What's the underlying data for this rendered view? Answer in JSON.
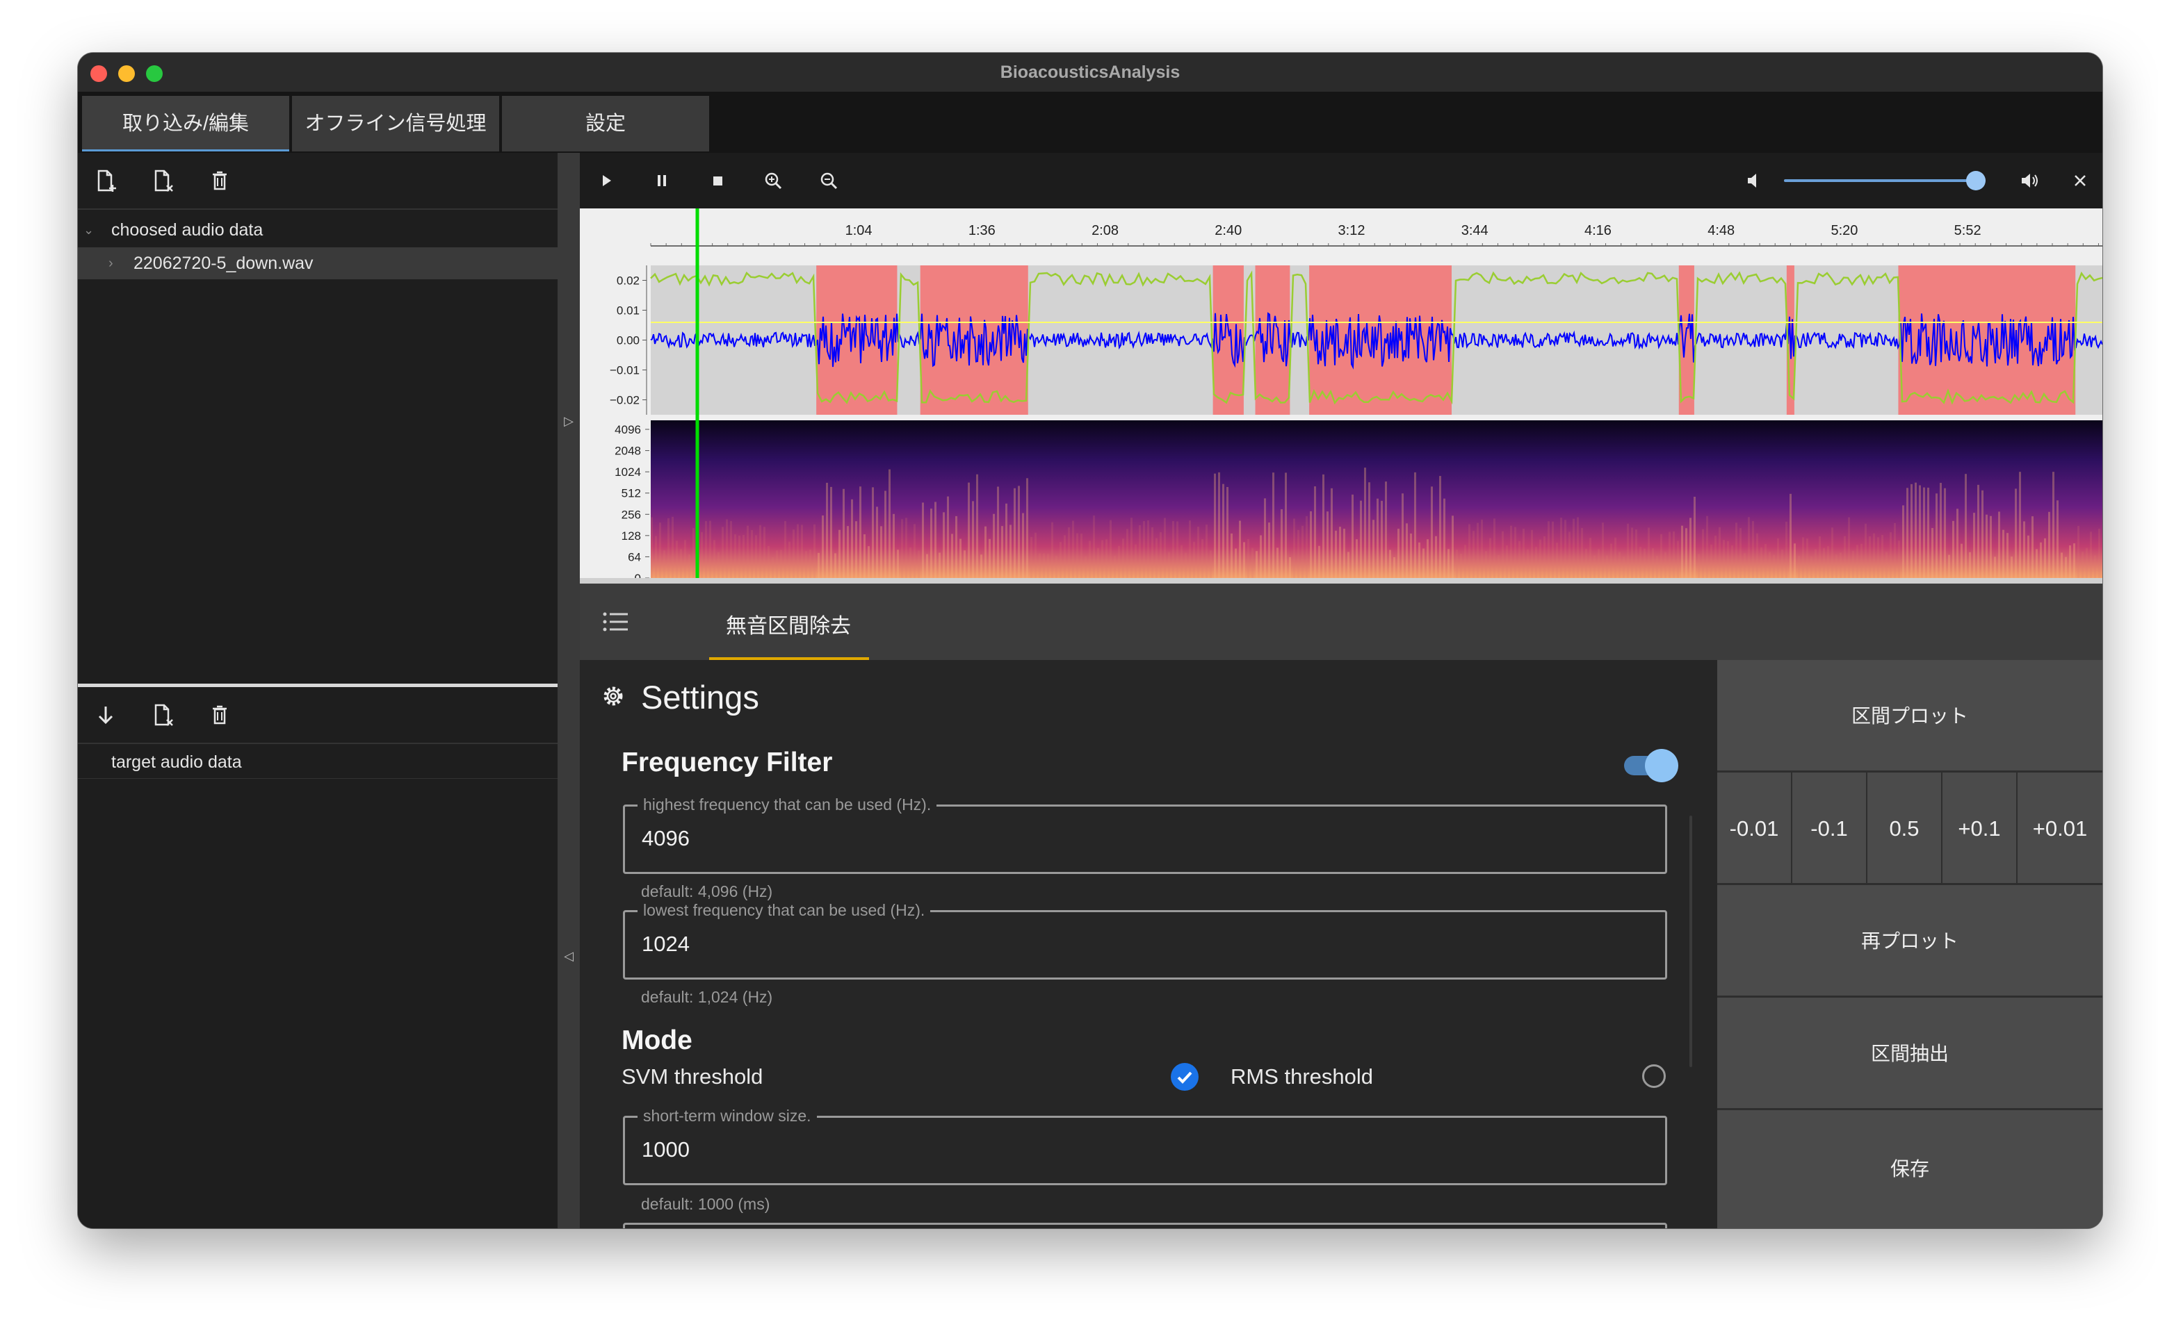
{
  "window": {
    "title": "BioacousticsAnalysis"
  },
  "tabs": [
    {
      "label": "取り込み/編集"
    },
    {
      "label": "オフライン信号処理"
    },
    {
      "label": "設定"
    }
  ],
  "left_panel": {
    "source_tree": {
      "root_label": "choosed audio data",
      "children": [
        "22062720-5_down.wav"
      ]
    },
    "target_tree": {
      "root_label": "target audio data"
    }
  },
  "player": {
    "icons": [
      "play-icon",
      "pause-icon",
      "stop-icon",
      "zoom-in-icon",
      "zoom-out-icon",
      "volume-mute-icon",
      "volume-up-icon",
      "close-icon"
    ],
    "volume": 1.0
  },
  "chart_data": [
    {
      "type": "line",
      "time_ticks": [
        "1:04",
        "1:36",
        "2:08",
        "2:40",
        "3:12",
        "3:44",
        "4:16",
        "4:48",
        "5:20",
        "5:52"
      ],
      "y_ticks": [
        "0.02",
        "0.01",
        "0.00",
        "−0.01",
        "−0.02"
      ],
      "ylim": [
        -0.025,
        0.025
      ],
      "highlight_segments_sec": [
        [
          53,
          74
        ],
        [
          80,
          108
        ],
        [
          156,
          164
        ],
        [
          167,
          176
        ],
        [
          181,
          218
        ],
        [
          277,
          281
        ],
        [
          305,
          307
        ],
        [
          334,
          380
        ]
      ],
      "colors": {
        "waveform": "#0000ff",
        "segments": "#f08080",
        "rms": "#9acd32",
        "threshold": "#ffff66",
        "playhead": "#00dd00",
        "background": "#d3d3d3"
      }
    },
    {
      "type": "heatmap",
      "y_ticks": [
        "4096",
        "2048",
        "1024",
        "512",
        "256",
        "128",
        "64",
        "0"
      ],
      "colormap": "magma"
    }
  ],
  "inner_tab": {
    "menu_icon": "list-icon",
    "label": "無音区間除去"
  },
  "settings": {
    "title": "Settings",
    "freq_filter": {
      "title": "Frequency Filter",
      "enabled": true,
      "high_label": "highest frequency that can be used (Hz).",
      "high_value": "4096",
      "high_hint": "default: 4,096 (Hz)",
      "low_label": "lowest frequency that can be used (Hz).",
      "low_value": "1024",
      "low_hint": "default: 1,024 (Hz)"
    },
    "mode": {
      "title": "Mode",
      "svm_label": "SVM threshold",
      "rms_label": "RMS threshold",
      "svm_checked": true,
      "rms_checked": false
    },
    "window": {
      "label": "short-term window size.",
      "value": "1000",
      "hint": "default: 1000 (ms)"
    }
  },
  "side_buttons": {
    "plot_segments": "区間プロット",
    "steps": [
      "-0.01",
      "-0.1",
      "0.5",
      "+0.1",
      "+0.01"
    ],
    "replot": "再プロット",
    "extract": "区間抽出",
    "save": "保存"
  }
}
